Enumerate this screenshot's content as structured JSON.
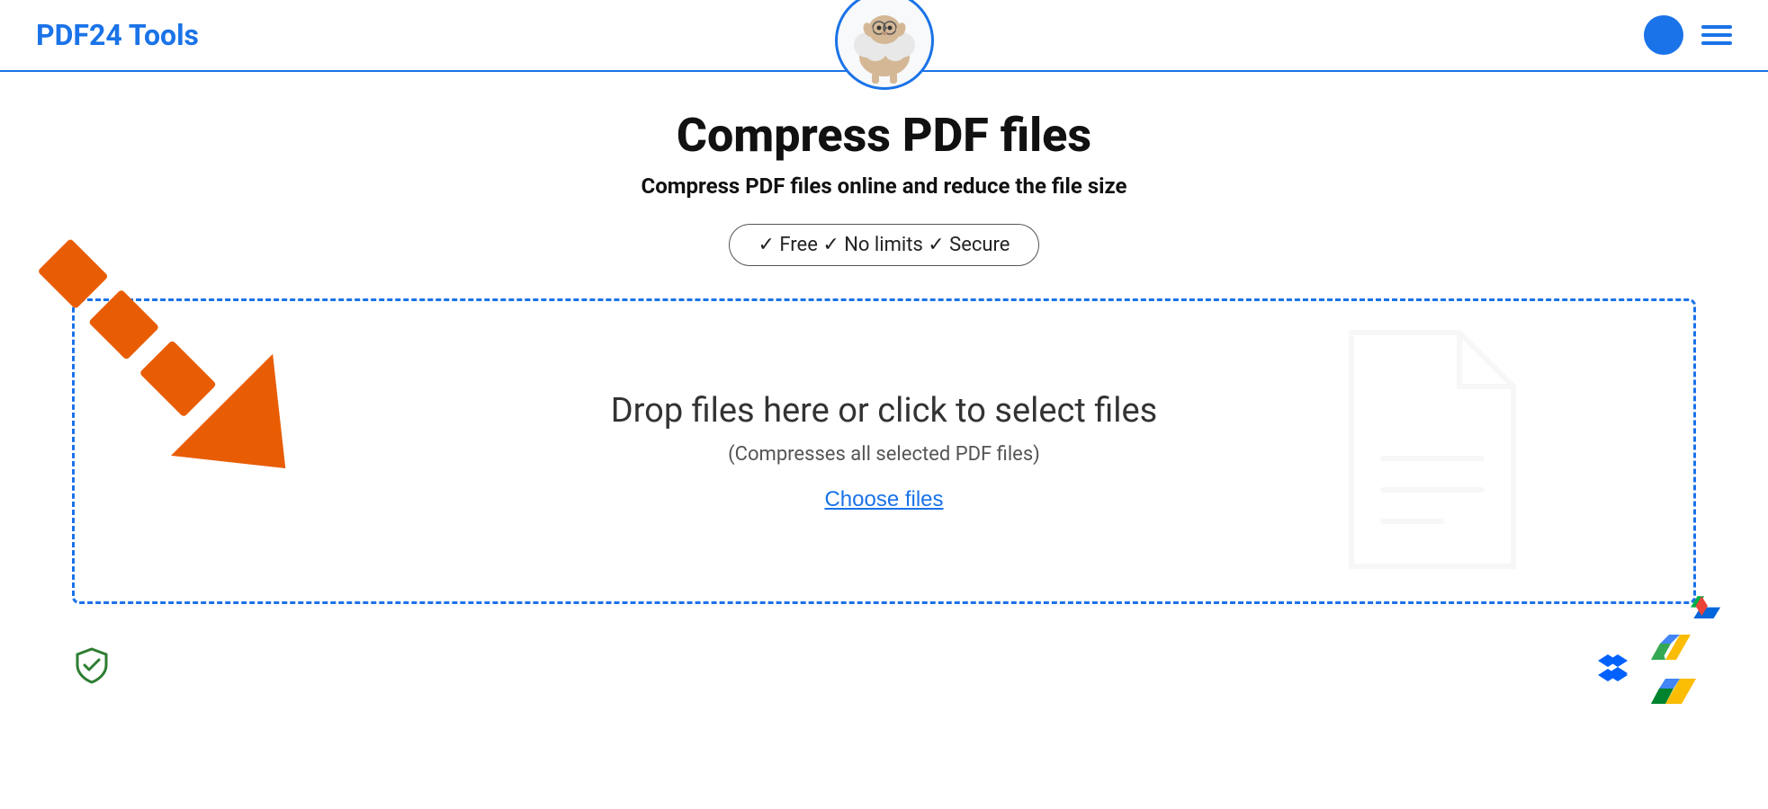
{
  "header": {
    "logo_text": "PDF24 Tools",
    "menu_label": "Menu"
  },
  "page": {
    "title": "Compress PDF files",
    "subtitle": "Compress PDF files online and reduce the file size",
    "badge": "✓ Free  ✓ No limits  ✓ Secure"
  },
  "dropzone": {
    "main_text": "Drop files here or click to select files",
    "sub_text": "(Compresses all selected PDF files)",
    "choose_files_label": "Choose files"
  },
  "footer": {
    "security_text": "Secure",
    "cloud_services": [
      "Dropbox",
      "Google Drive"
    ]
  },
  "colors": {
    "brand_blue": "#1a73e8",
    "orange": "#e85d04",
    "green": "#2e7d32"
  }
}
